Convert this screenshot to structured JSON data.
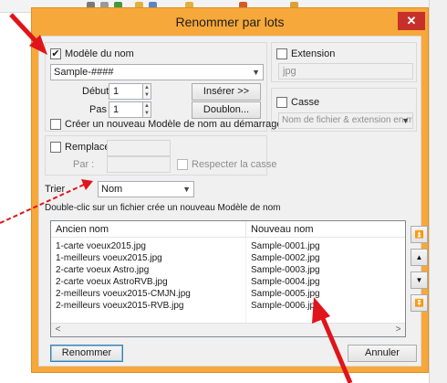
{
  "dialog": {
    "title": "Renommer par lots",
    "close_glyph": "✕"
  },
  "name_model": {
    "checkbox_label": "Modèle du nom",
    "checked": true,
    "pattern_value": "Sample-####",
    "start_label": "Début:",
    "start_value": "1",
    "step_label": "Pas :",
    "step_value": "1",
    "insert_button": "Insérer >>",
    "duplicate_button": "Doublon...",
    "create_model_label": "Créer un nouveau Modèle de nom au démarrage"
  },
  "extension": {
    "checkbox_label": "Extension",
    "value": "jpg"
  },
  "case": {
    "checkbox_label": "Casse",
    "selected": "Nom de fichier & extension en minuscu"
  },
  "replace": {
    "checkbox_label": "Remplacer",
    "by_label": "Par :",
    "respect_case_label": "Respecter la casse"
  },
  "sort": {
    "label": "Trier",
    "selected": "Nom"
  },
  "hint": "Double-clic sur un fichier crée un nouveau Modèle de nom",
  "file_list": {
    "columns": [
      "Ancien nom",
      "Nouveau nom"
    ],
    "rows": [
      [
        "1-carte voeux2015.jpg",
        "Sample-0001.jpg"
      ],
      [
        "1-meilleurs voeux2015.jpg",
        "Sample-0002.jpg"
      ],
      [
        "2-carte voeux Astro.jpg",
        "Sample-0003.jpg"
      ],
      [
        "2-carte voeux AstroRVB.jpg",
        "Sample-0004.jpg"
      ],
      [
        "2-meilleurs voeux2015-CMJN.jpg",
        "Sample-0005.jpg"
      ],
      [
        "2-meilleurs voeux2015-RVB.jpg",
        "Sample-0006.jpg"
      ]
    ],
    "scroll_left_glyph": "<",
    "scroll_right_glyph": ">"
  },
  "nav_buttons": {
    "top": "⏫",
    "up": "▲",
    "down": "▼",
    "bottom": "⏬"
  },
  "footer": {
    "rename_button": "Renommer",
    "cancel_button": "Annuler"
  },
  "colors": {
    "title_bar": "#f7a83a",
    "close_button": "#c7302a",
    "annotation_arrow": "#e0141b"
  }
}
